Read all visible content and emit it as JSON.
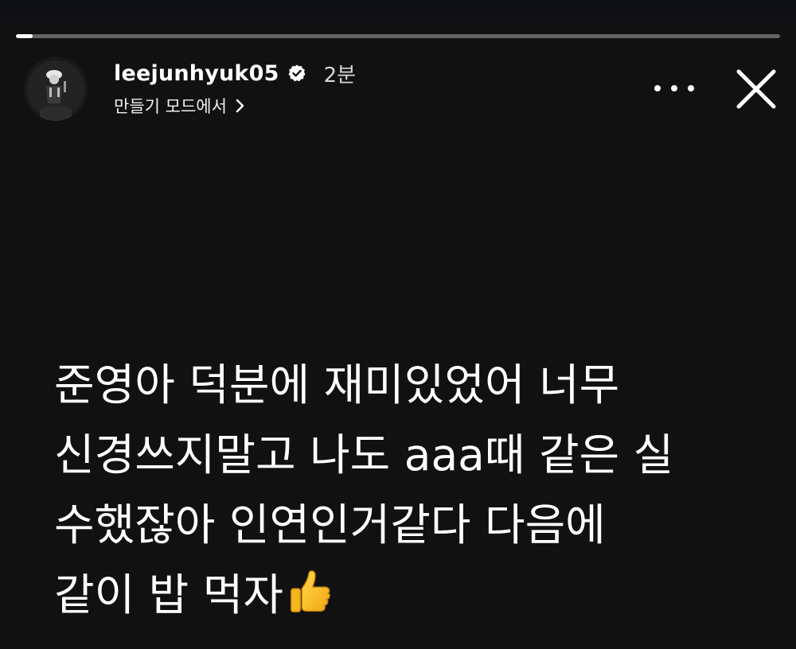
{
  "story": {
    "progress_fraction": 0.022,
    "username": "leejunhyuk05",
    "verified_icon": "verified-badge-icon",
    "time": "2분",
    "subtitle": "만들기 모드에서",
    "more_icon": "more-horizontal-icon",
    "close_icon": "close-icon",
    "avatar_icon": "profile-avatar",
    "message_lines": [
      "준영아 덕분에 재미있었어 너무",
      "신경쓰지말고 나도 aaa때 같은 실",
      "수했잖아 인연인거같다 다음에",
      "같이 밥 먹자"
    ],
    "message_emoji": "thumbs-up-icon",
    "colors": {
      "background": "#111111",
      "text": "#ffffff",
      "verified": "#ffffff"
    }
  }
}
